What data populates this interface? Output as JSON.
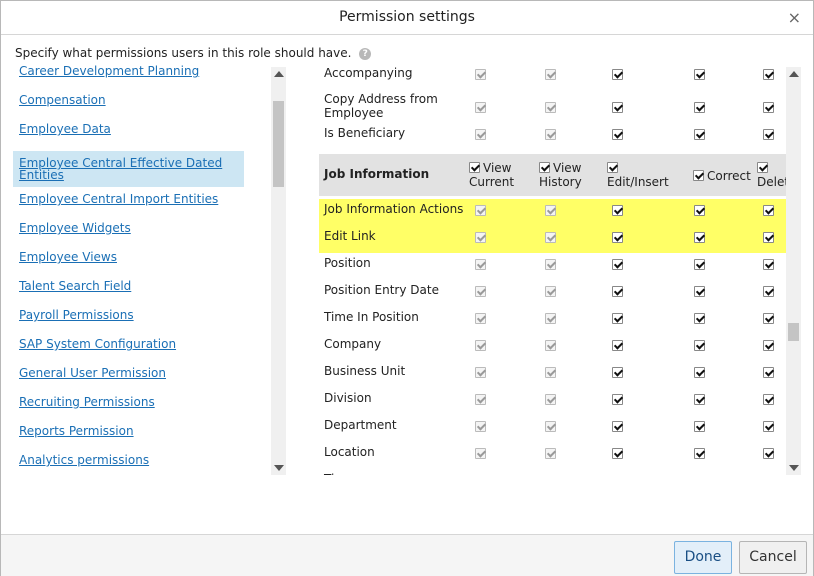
{
  "dialog": {
    "title": "Permission settings",
    "close_glyph": "×",
    "instruction": "Specify what permissions users in this role should have.",
    "help_glyph": "?"
  },
  "categories": [
    {
      "label": "Career Development Planning",
      "selected": false
    },
    {
      "label": "Compensation",
      "selected": false
    },
    {
      "label": "Employee Data",
      "selected": false
    },
    {
      "label": "Employee Central Effective Dated Entities",
      "selected": true
    },
    {
      "label": "Employee Central Import Entities",
      "selected": false
    },
    {
      "label": "Employee Widgets",
      "selected": false
    },
    {
      "label": "Employee Views",
      "selected": false
    },
    {
      "label": "Talent Search Field",
      "selected": false
    },
    {
      "label": "Payroll Permissions",
      "selected": false
    },
    {
      "label": "SAP System Configuration",
      "selected": false
    },
    {
      "label": "General User Permission",
      "selected": false
    },
    {
      "label": "Recruiting Permissions",
      "selected": false
    },
    {
      "label": "Reports Permission",
      "selected": false
    },
    {
      "label": "Analytics permissions",
      "selected": false
    }
  ],
  "permissions": {
    "columns": [
      {
        "line1": "View",
        "line2": "Current"
      },
      {
        "line1": "View",
        "line2": "History"
      },
      {
        "line1": "",
        "line2": "Edit/Insert"
      },
      {
        "line1": "Correct",
        "line2": ""
      },
      {
        "line1": "",
        "line2": "Delet"
      }
    ],
    "rows": [
      {
        "label": "Accompanying",
        "type": "field"
      },
      {
        "label": "Copy Address from Employee",
        "type": "field"
      },
      {
        "label": "Is Beneficiary",
        "type": "field"
      },
      {
        "label": "Job Information",
        "type": "header"
      },
      {
        "label": "Job Information Actions",
        "type": "field",
        "highlighted": true
      },
      {
        "label": "Edit Link",
        "type": "field",
        "highlighted": true
      },
      {
        "label": "Position",
        "type": "field"
      },
      {
        "label": "Position Entry Date",
        "type": "field"
      },
      {
        "label": "Time In Position",
        "type": "field"
      },
      {
        "label": "Company",
        "type": "field"
      },
      {
        "label": "Business Unit",
        "type": "field"
      },
      {
        "label": "Division",
        "type": "field"
      },
      {
        "label": "Department",
        "type": "field"
      },
      {
        "label": "Location",
        "type": "field"
      },
      {
        "label": "Ti",
        "type": "field"
      }
    ]
  },
  "footer": {
    "done_label": "Done",
    "cancel_label": "Cancel"
  },
  "colors": {
    "link": "#1a6fb5",
    "selected_bg": "#cde6f3",
    "highlight": "#ffff66",
    "header_bg": "#e2e2e2"
  }
}
